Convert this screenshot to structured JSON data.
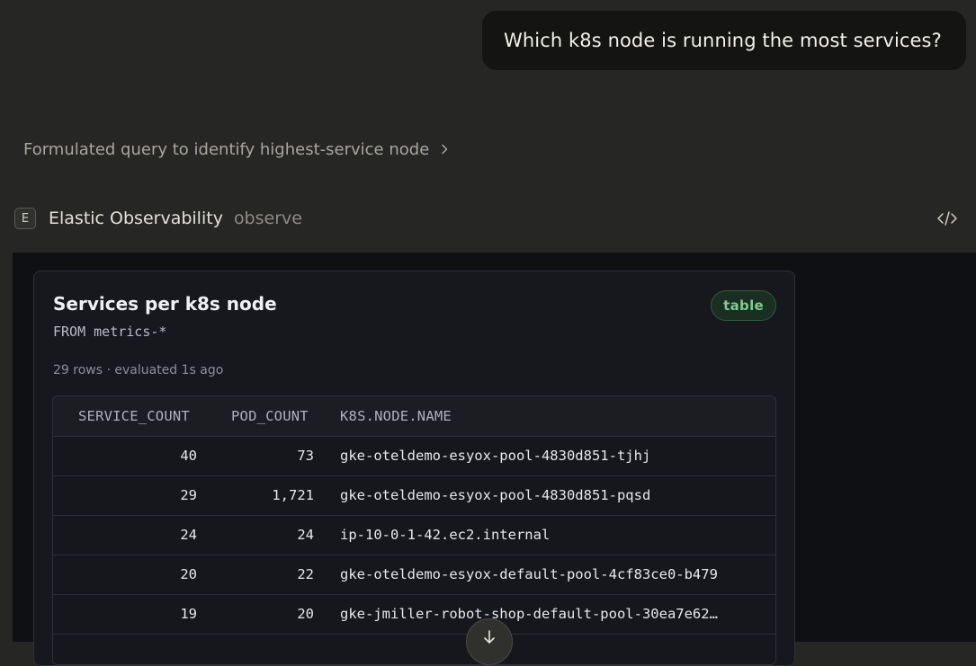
{
  "user_message": "Which k8s node is running the most services?",
  "thinking": {
    "label": "Formulated query to identify highest-service node"
  },
  "tool": {
    "badge": "E",
    "name": "Elastic Observability",
    "action": "observe"
  },
  "card": {
    "title": "Services per k8s node",
    "query": "FROM metrics-*",
    "type_badge": "table",
    "meta": "29 rows · evaluated 1s ago",
    "columns": [
      "SERVICE_COUNT",
      "POD_COUNT",
      "K8S.NODE.NAME"
    ],
    "rows": [
      [
        "40",
        "73",
        "gke-oteldemo-esyox-pool-4830d851-tjhj"
      ],
      [
        "29",
        "1,721",
        "gke-oteldemo-esyox-pool-4830d851-pqsd"
      ],
      [
        "24",
        "24",
        "ip-10-0-1-42.ec2.internal"
      ],
      [
        "20",
        "22",
        "gke-oteldemo-esyox-default-pool-4cf83ce0-b479"
      ],
      [
        "19",
        "20",
        "gke-jmiller-robot-shop-default-pool-30ea7e62…"
      ]
    ]
  },
  "colors": {
    "page_bg": "#262624",
    "result_bg": "#0f1014",
    "badge_green": "#7fca8f"
  },
  "icons": {
    "thinking_chevron": "chevron-right-icon",
    "code_toggle": "code-icon",
    "scroll_down": "arrow-down-icon"
  }
}
